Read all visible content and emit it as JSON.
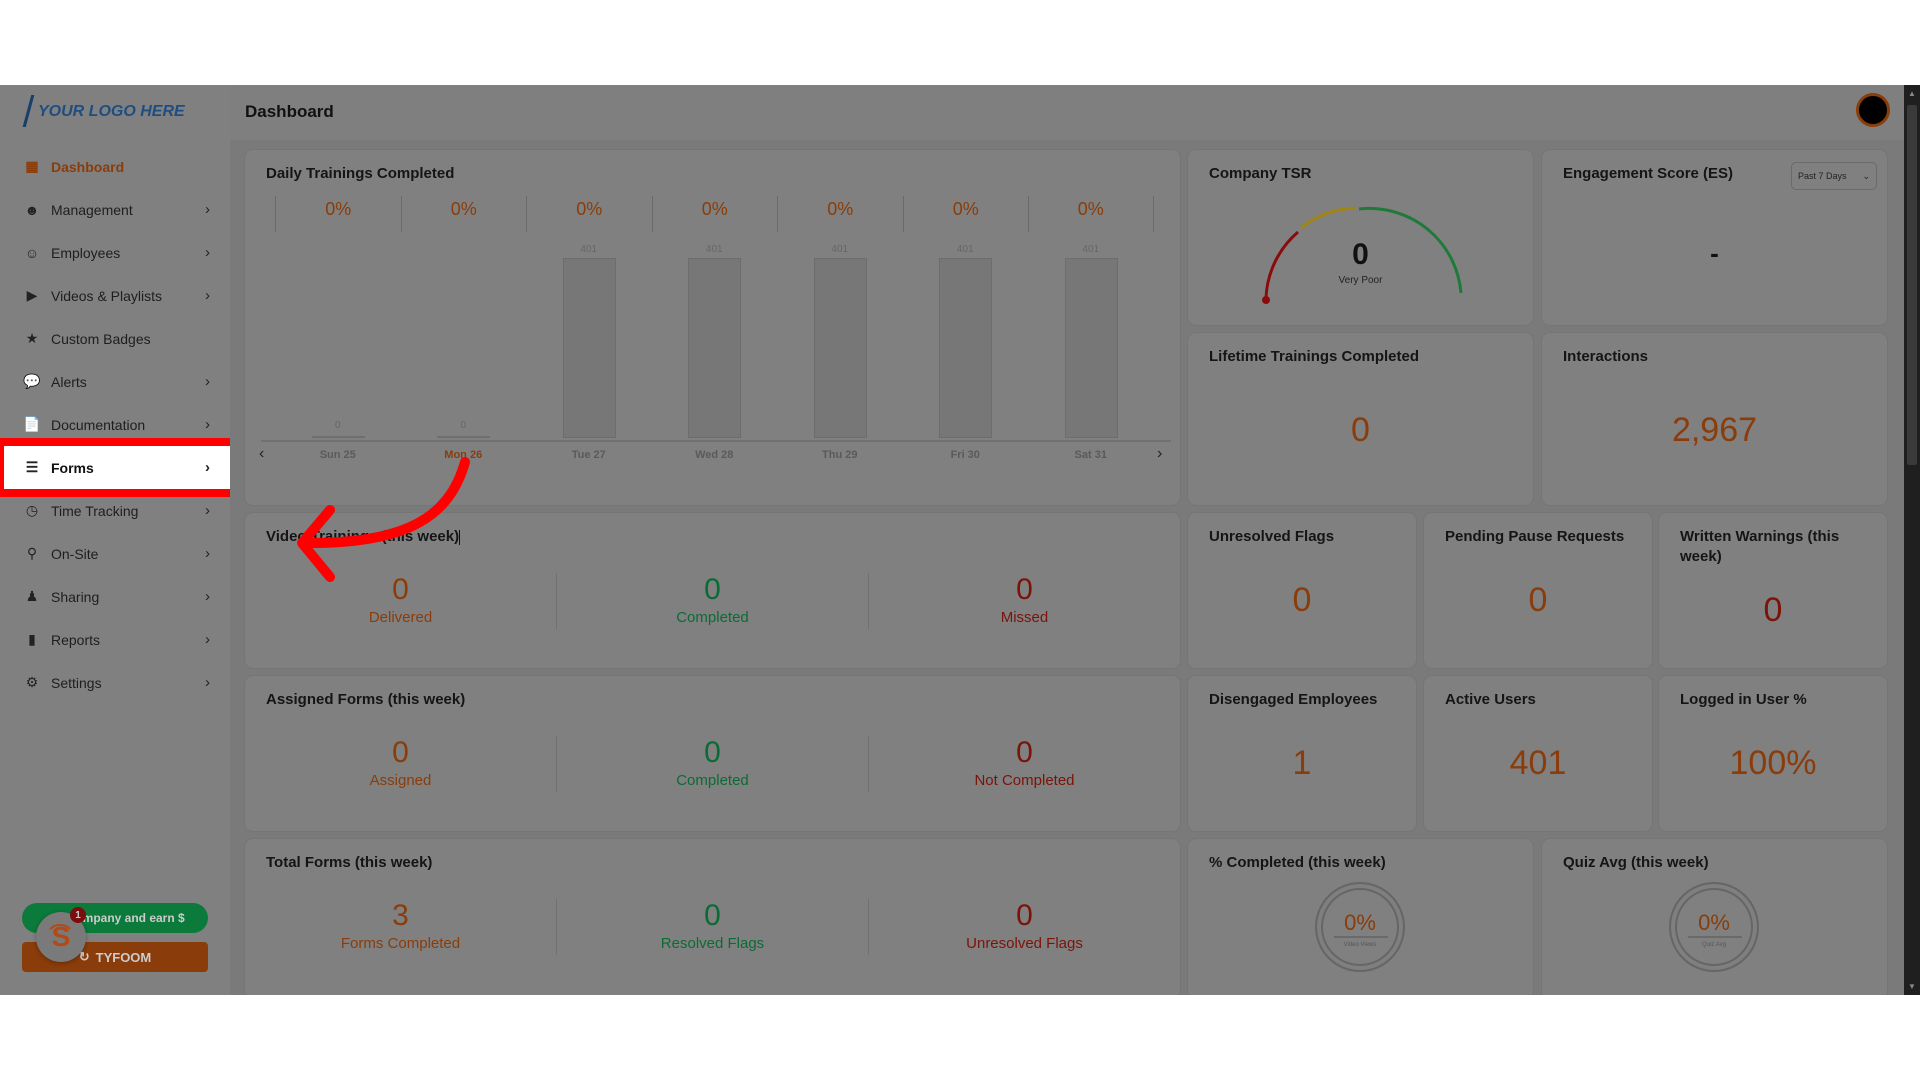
{
  "app": {
    "logo_text": "YOUR LOGO HERE",
    "page_title": "Dashboard"
  },
  "sidebar": {
    "items": [
      {
        "label": "Dashboard",
        "icon": "dashboard-icon",
        "active": true
      },
      {
        "label": "Management",
        "icon": "management-icon"
      },
      {
        "label": "Employees",
        "icon": "employee-icon"
      },
      {
        "label": "Videos & Playlists",
        "icon": "video-icon"
      },
      {
        "label": "Custom Badges",
        "icon": "badge-icon"
      },
      {
        "label": "Alerts",
        "icon": "chat-icon"
      },
      {
        "label": "Documentation",
        "icon": "document-icon"
      },
      {
        "label": "Forms",
        "icon": "forms-icon",
        "highlighted": true
      },
      {
        "label": "Time Tracking",
        "icon": "clock-icon"
      },
      {
        "label": "On-Site",
        "icon": "location-pin-icon"
      },
      {
        "label": "Sharing",
        "icon": "share-user-icon"
      },
      {
        "label": "Reports",
        "icon": "bar-chart-icon"
      },
      {
        "label": "Settings",
        "icon": "gear-icon"
      }
    ],
    "refer_label": "Refer a company and earn $",
    "refer_visible": "ompany and earn $",
    "tyfoom_label": "TYFOOM",
    "notification_count": "1"
  },
  "daily_trainings": {
    "title": "Daily Trainings Completed",
    "days": [
      {
        "label": "Sun 25",
        "pct": "0%",
        "value": 0,
        "value_label": "0"
      },
      {
        "label": "Mon 26",
        "pct": "0%",
        "value": 0,
        "value_label": "0",
        "current": true
      },
      {
        "label": "Tue 27",
        "pct": "0%",
        "value": 401,
        "value_label": "401"
      },
      {
        "label": "Wed 28",
        "pct": "0%",
        "value": 401,
        "value_label": "401"
      },
      {
        "label": "Thu 29",
        "pct": "0%",
        "value": 401,
        "value_label": "401"
      },
      {
        "label": "Fri 30",
        "pct": "0%",
        "value": 401,
        "value_label": "401"
      },
      {
        "label": "Sat 31",
        "pct": "0%",
        "value": 401,
        "value_label": "401"
      }
    ],
    "max": 401
  },
  "company_tsr": {
    "title": "Company TSR",
    "value": "0",
    "rating": "Very Poor"
  },
  "engagement": {
    "title": "Engagement Score (ES)",
    "value": "-",
    "range": "Past 7 Days"
  },
  "lifetime": {
    "title": "Lifetime Trainings Completed",
    "value": "0"
  },
  "interactions": {
    "title": "Interactions",
    "value": "2,967"
  },
  "video_trainings": {
    "title": "Video Trainings (this week)",
    "stats": [
      {
        "value": "0",
        "label": "Delivered"
      },
      {
        "value": "0",
        "label": "Completed"
      },
      {
        "value": "0",
        "label": "Missed"
      }
    ]
  },
  "unresolved_flags": {
    "title": "Unresolved Flags",
    "value": "0"
  },
  "pending_pause": {
    "title": "Pending Pause Requests",
    "value": "0"
  },
  "written_warnings": {
    "title": "Written Warnings (this week)",
    "value": "0"
  },
  "assigned_forms": {
    "title": "Assigned Forms (this week)",
    "stats": [
      {
        "value": "0",
        "label": "Assigned"
      },
      {
        "value": "0",
        "label": "Completed"
      },
      {
        "value": "0",
        "label": "Not Completed"
      }
    ]
  },
  "disengaged": {
    "title": "Disengaged Employees",
    "value": "1"
  },
  "active_users": {
    "title": "Active Users",
    "value": "401"
  },
  "logged_in": {
    "title": "Logged in User %",
    "value": "100%"
  },
  "total_forms": {
    "title": "Total Forms (this week)",
    "stats": [
      {
        "value": "3",
        "label": "Forms Completed"
      },
      {
        "value": "0",
        "label": "Resolved Flags"
      },
      {
        "value": "0",
        "label": "Unresolved Flags"
      }
    ]
  },
  "pct_completed": {
    "title": "% Completed (this week)",
    "value": "0%",
    "sublabel": "Video Views"
  },
  "quiz_avg": {
    "title": "Quiz Avg (this week)",
    "value": "0%",
    "sublabel": "Quiz Avg"
  },
  "colors": {
    "accent": "#b34a15",
    "green": "#0b6b34",
    "red": "#7a1408",
    "highlight": "#ff0000"
  }
}
